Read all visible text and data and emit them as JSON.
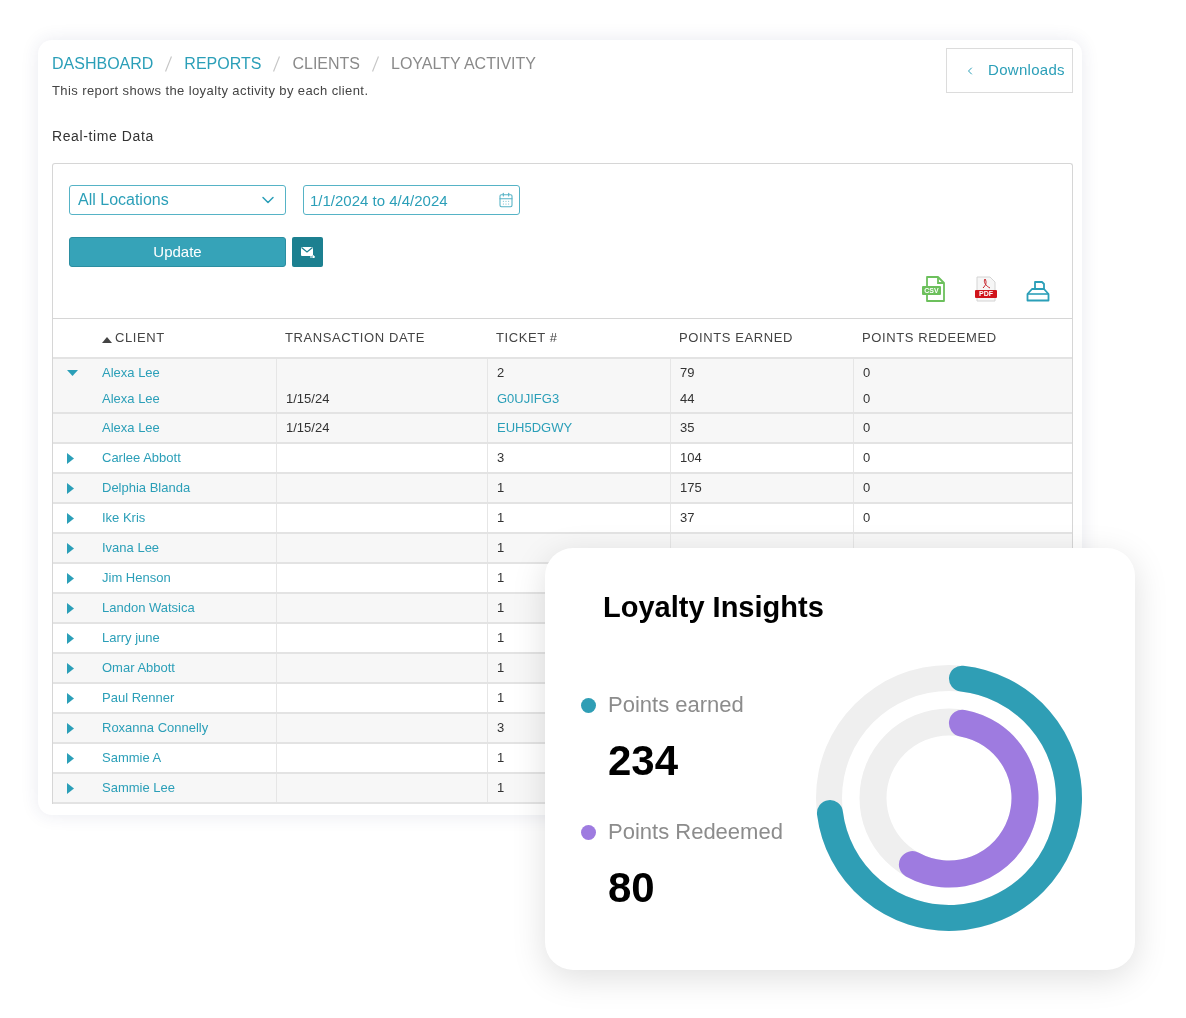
{
  "breadcrumb": [
    {
      "label": "DASHBOARD",
      "link": true
    },
    {
      "label": "REPORTS",
      "link": true
    },
    {
      "label": "CLIENTS",
      "link": false
    },
    {
      "label": "LOYALTY ACTIVITY",
      "link": false
    }
  ],
  "description": "This report shows the loyalty activity by each client.",
  "downloads_button": {
    "label": "Downloads"
  },
  "section_title": "Real-time Data",
  "filters": {
    "location": {
      "value": "All Locations"
    },
    "date_range": {
      "value": "1/1/2024 to 4/4/2024"
    },
    "update_button": {
      "label": "Update"
    }
  },
  "export_buttons": [
    {
      "kind": "csv",
      "label": "CSV"
    },
    {
      "kind": "pdf",
      "label": "PDF"
    },
    {
      "kind": "print"
    }
  ],
  "table": {
    "columns": [
      {
        "label": "CLIENT",
        "sorted": true
      },
      {
        "label": "TRANSACTION DATE",
        "sorted": false
      },
      {
        "label": "TICKET #",
        "sorted": false
      },
      {
        "label": "POINTS EARNED",
        "sorted": false
      },
      {
        "label": "POINTS REDEEMED",
        "sorted": false
      }
    ],
    "rows": [
      {
        "client": "Alexa Lee",
        "ticket": "2",
        "points_earned": "79",
        "points_redeemed": "0",
        "expanded": true,
        "children": [
          {
            "client": "Alexa Lee",
            "date": "1/15/24",
            "ticket": "G0UJIFG3",
            "points_earned": "44",
            "points_redeemed": "0"
          },
          {
            "client": "Alexa Lee",
            "date": "1/15/24",
            "ticket": "EUH5DGWY",
            "points_earned": "35",
            "points_redeemed": "0"
          }
        ]
      },
      {
        "client": "Carlee Abbott",
        "ticket": "3",
        "points_earned": "104",
        "points_redeemed": "0",
        "expanded": false
      },
      {
        "client": "Delphia Blanda",
        "ticket": "1",
        "points_earned": "175",
        "points_redeemed": "0",
        "expanded": false
      },
      {
        "client": "Ike Kris",
        "ticket": "1",
        "points_earned": "37",
        "points_redeemed": "0",
        "expanded": false
      },
      {
        "client": "Ivana Lee",
        "ticket": "1",
        "expanded": false
      },
      {
        "client": "Jim Henson",
        "ticket": "1",
        "expanded": false
      },
      {
        "client": "Landon Watsica",
        "ticket": "1",
        "expanded": false
      },
      {
        "client": "Larry june",
        "ticket": "1",
        "expanded": false
      },
      {
        "client": "Omar Abbott",
        "ticket": "1",
        "expanded": false
      },
      {
        "client": "Paul Renner",
        "ticket": "1",
        "expanded": false
      },
      {
        "client": "Roxanna Connelly",
        "ticket": "3",
        "expanded": false
      },
      {
        "client": "Sammie A",
        "ticket": "1",
        "expanded": false
      },
      {
        "client": "Sammie Lee",
        "ticket": "1",
        "expanded": false
      }
    ]
  },
  "insights": {
    "title": "Loyalty Insights",
    "metrics": [
      {
        "label": "Points earned",
        "value": "234",
        "color": "#2f9eb5"
      },
      {
        "label": "Points Redeemed",
        "value": "80",
        "color": "#9e7be0"
      }
    ]
  }
}
